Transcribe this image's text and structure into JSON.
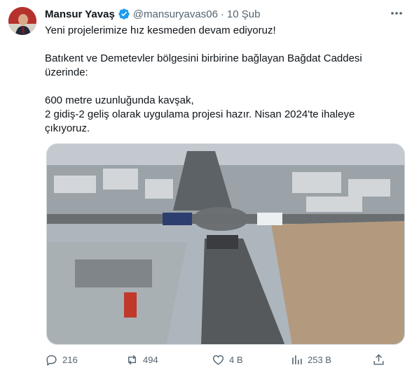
{
  "tweet": {
    "display_name": "Mansur Yavaş",
    "handle": "@mansuryavas06",
    "separator": "·",
    "date": "10 Şub",
    "lines": [
      "Yeni projelerimize hız kesmeden  devam ediyoruz!",
      "Batıkent ve Demetevler bölgesini birbirine bağlayan Bağdat Caddesi üzerinde:",
      "600 metre uzunluğunda kavşak,\n2 gidiş-2 geliş olarak uygulama projesi hazır. Nisan 2024'te ihaleye çıkıyoruz."
    ]
  },
  "actions": {
    "replies": "216",
    "reposts": "494",
    "likes": "4 B",
    "views": "253 B"
  },
  "colors": {
    "verified": "#1d9bf0",
    "muted": "#536471",
    "text": "#0f1419"
  },
  "icons": [
    "verified-badge-icon",
    "more-icon",
    "reply-icon",
    "repost-icon",
    "like-icon",
    "views-icon",
    "share-icon"
  ]
}
